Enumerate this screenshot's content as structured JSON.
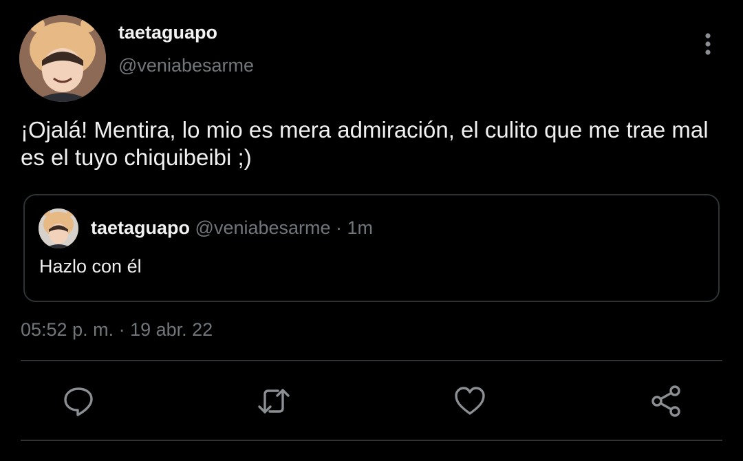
{
  "author": {
    "display_name": "taetaguapo",
    "handle": "@veniabesarme"
  },
  "tweet": {
    "text": "¡Ojalá! Mentira, lo mio es mera admiración, el culito que me trae mal es el tuyo chiquibeibi ;)",
    "timestamp": "05:52 p. m. · 19 abr. 22"
  },
  "quoted_tweet": {
    "display_name": "taetaguapo",
    "meta": "@veniabesarme · 1m",
    "text": "Hazlo con él"
  },
  "icons": {
    "more": "more-vertical-icon",
    "reply": "reply-icon",
    "retweet": "retweet-icon",
    "like": "heart-icon",
    "share": "share-icon"
  },
  "colors": {
    "background": "#000000",
    "primary_text": "#e7e9ea",
    "secondary_text": "#71767b",
    "border": "#2f3336"
  }
}
